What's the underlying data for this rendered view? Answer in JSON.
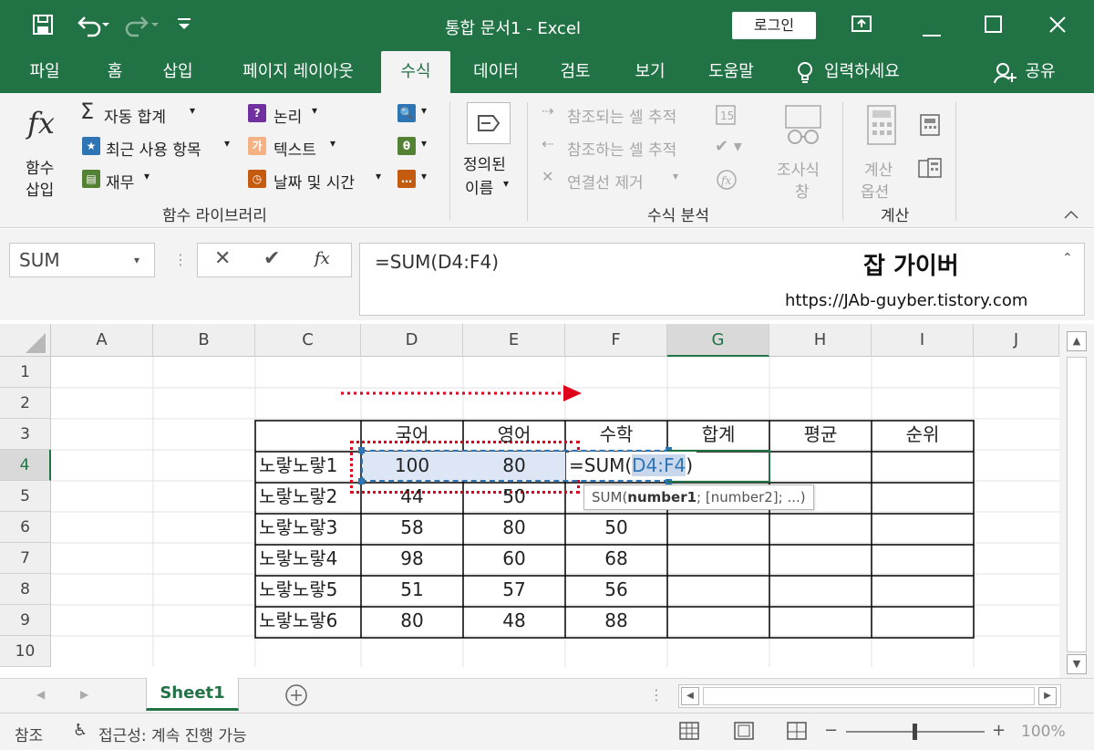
{
  "titlebar": {
    "title": "통합 문서1  -  Excel",
    "login": "로그인"
  },
  "tabs": [
    "파일",
    "홈",
    "삽입",
    "페이지 레이아웃",
    "수식",
    "데이터",
    "검토",
    "보기",
    "도움말",
    "입력하세요",
    "공유"
  ],
  "ribbon": {
    "insert_fn": [
      "함수",
      "삽입"
    ],
    "autosum": "자동 합계",
    "recent": "최근 사용 항목",
    "finance": "재무",
    "logical": "논리",
    "text": "텍스트",
    "datetime": "날짜 및 시간",
    "defined_names": [
      "정의된",
      "이름"
    ],
    "trace_prec": "참조되는 셀 추적",
    "trace_dep": "참조하는 셀 추적",
    "remove_arrows": "연결선 제거",
    "watch": [
      "조사식",
      "창"
    ],
    "calc_options": [
      "계산",
      "옵션"
    ],
    "group_library": "함수 라이브러리",
    "group_audit": "수식 분석",
    "group_calc": "계산"
  },
  "formula_bar": {
    "name_box": "SUM",
    "formula": "=SUM(D4:F4)",
    "watermark_title": "잡 가이버",
    "watermark_url": "https://JAb-guyber.tistory.com"
  },
  "columns": [
    "A",
    "B",
    "C",
    "D",
    "E",
    "F",
    "G",
    "H",
    "I",
    "J"
  ],
  "rows": [
    "1",
    "2",
    "3",
    "4",
    "5",
    "6",
    "7",
    "8",
    "9",
    "10"
  ],
  "table": {
    "headers": [
      "국어",
      "영어",
      "수학",
      "합계",
      "평균",
      "순위"
    ],
    "names": [
      "노랗노랗1",
      "노랗노랗2",
      "노랗노랗3",
      "노랗노랗4",
      "노랗노랗5",
      "노랗노랗6"
    ],
    "data": [
      [
        "100",
        "80",
        ""
      ],
      [
        "44",
        "50",
        ""
      ],
      [
        "58",
        "80",
        "50"
      ],
      [
        "98",
        "60",
        "68"
      ],
      [
        "51",
        "57",
        "56"
      ],
      [
        "80",
        "48",
        "88"
      ]
    ]
  },
  "edit_cell": {
    "prefix": "=SUM(",
    "ref": "D4:F4",
    "suffix": ")"
  },
  "tooltip": {
    "fn": "SUM(",
    "bold": "number1",
    "rest": "; [number2]; ...)"
  },
  "sheet_tab": "Sheet1",
  "status": {
    "mode": "참조",
    "accessibility": "접근성: 계속 진행 가능",
    "zoom": "100%"
  },
  "colors": {
    "excel_green": "#217346",
    "selection_blue": "#4472c4",
    "arrow_red": "#e0001b"
  }
}
